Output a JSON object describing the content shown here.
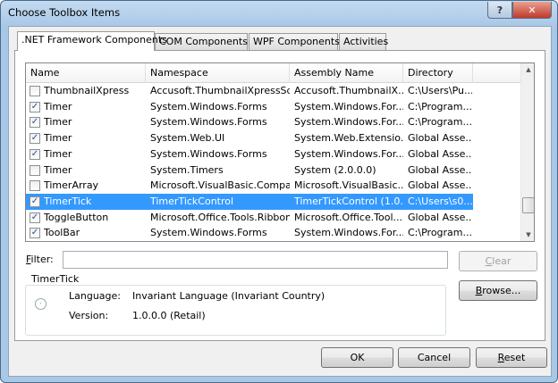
{
  "window": {
    "title": "Choose Toolbox Items",
    "help_icon": "question-icon",
    "close_icon": "close-icon"
  },
  "tabs": [
    {
      "label": ".NET Framework Components"
    },
    {
      "label": "COM Components"
    },
    {
      "label": "WPF Components"
    },
    {
      "label": "Activities"
    }
  ],
  "columns": [
    "Name",
    "Namespace",
    "Assembly Name",
    "Directory"
  ],
  "rows": [
    {
      "checked": false,
      "name": "ThumbnailXpress",
      "namespace": "Accusoft.ThumbnailXpressSdk",
      "assembly": "Accusoft.ThumbnailX...",
      "directory": "C:\\Users\\Pu..."
    },
    {
      "checked": true,
      "name": "Timer",
      "namespace": "System.Windows.Forms",
      "assembly": "System.Windows.For...",
      "directory": "C:\\Program..."
    },
    {
      "checked": true,
      "name": "Timer",
      "namespace": "System.Windows.Forms",
      "assembly": "System.Windows.For...",
      "directory": "C:\\Program..."
    },
    {
      "checked": true,
      "name": "Timer",
      "namespace": "System.Web.UI",
      "assembly": "System.Web.Extensio...",
      "directory": "Global Asse..."
    },
    {
      "checked": true,
      "name": "Timer",
      "namespace": "System.Windows.Forms",
      "assembly": "System.Windows.For...",
      "directory": "Global Asse..."
    },
    {
      "checked": false,
      "name": "Timer",
      "namespace": "System.Timers",
      "assembly": "System (2.0.0.0)",
      "directory": "Global Asse..."
    },
    {
      "checked": false,
      "name": "TimerArray",
      "namespace": "Microsoft.VisualBasic.Compa...",
      "assembly": "Microsoft.VisualBasic....",
      "directory": "Global Asse..."
    },
    {
      "checked": true,
      "selected": true,
      "name": "TimerTick",
      "namespace": "TimerTickControl",
      "assembly": "TimerTickControl (1.0...",
      "directory": "C:\\Users\\s0..."
    },
    {
      "checked": true,
      "name": "ToggleButton",
      "namespace": "Microsoft.Office.Tools.Ribbon",
      "assembly": "Microsoft.Office.Tool...",
      "directory": "Global Asse..."
    },
    {
      "checked": true,
      "name": "ToolBar",
      "namespace": "System.Windows.Forms",
      "assembly": "System.Windows.For...",
      "directory": "C:\\Program..."
    }
  ],
  "filter": {
    "label_key": "F",
    "label_rest": "ilter:",
    "value": ""
  },
  "details": {
    "title": "TimerTick",
    "icon": "alarm-clock-icon",
    "language_label": "Language:",
    "language": "Invariant Language (Invariant Country)",
    "version_label": "Version:",
    "version": "1.0.0.0 (Retail)"
  },
  "buttons": {
    "clear_key": "C",
    "clear_rest": "lear",
    "browse_key": "B",
    "browse_rest": "rowse...",
    "ok": "OK",
    "cancel": "Cancel",
    "reset_key": "R",
    "reset_rest": "eset"
  }
}
